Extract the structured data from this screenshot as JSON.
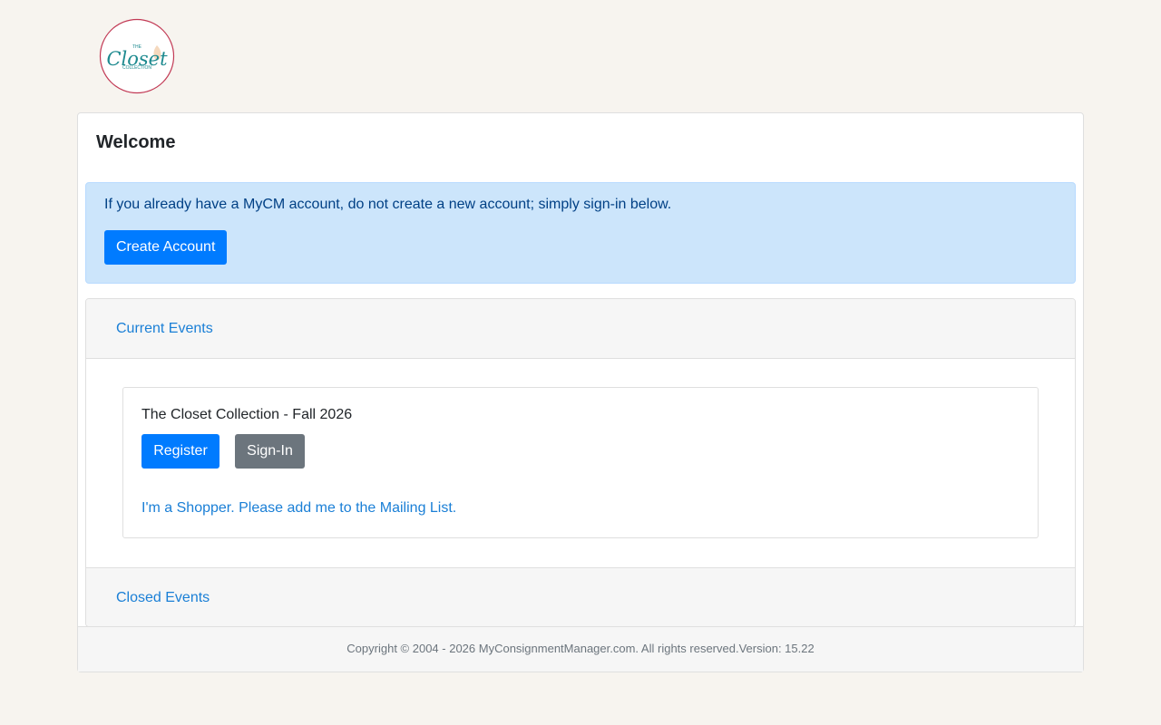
{
  "logo": {
    "text_top": "THE",
    "text_main": "Closet",
    "text_bottom": "COLLECTION",
    "ring_color": "#c23a55",
    "text_color": "#1d8a8f"
  },
  "welcome": {
    "title": "Welcome"
  },
  "alert": {
    "message": "If you already have a MyCM account, do not create a new account; simply sign-in below.",
    "create_account_label": "Create Account"
  },
  "events": {
    "current_label": "Current Events",
    "closed_label": "Closed Events",
    "items": [
      {
        "title": "The Closet Collection - Fall 2026",
        "register_label": "Register",
        "signin_label": "Sign-In",
        "mailing_link": "I'm a Shopper. Please add me to the Mailing List."
      }
    ]
  },
  "footer": {
    "text": "Copyright © 2004 - 2026 MyConsignmentManager.com. All rights reserved.Version: 15.22"
  },
  "colors": {
    "page_bg": "#f7f4ef",
    "primary": "#007bff",
    "secondary": "#6c757d",
    "link": "#1a7fd6",
    "alert_bg": "#cce5fb",
    "alert_text": "#004085"
  }
}
